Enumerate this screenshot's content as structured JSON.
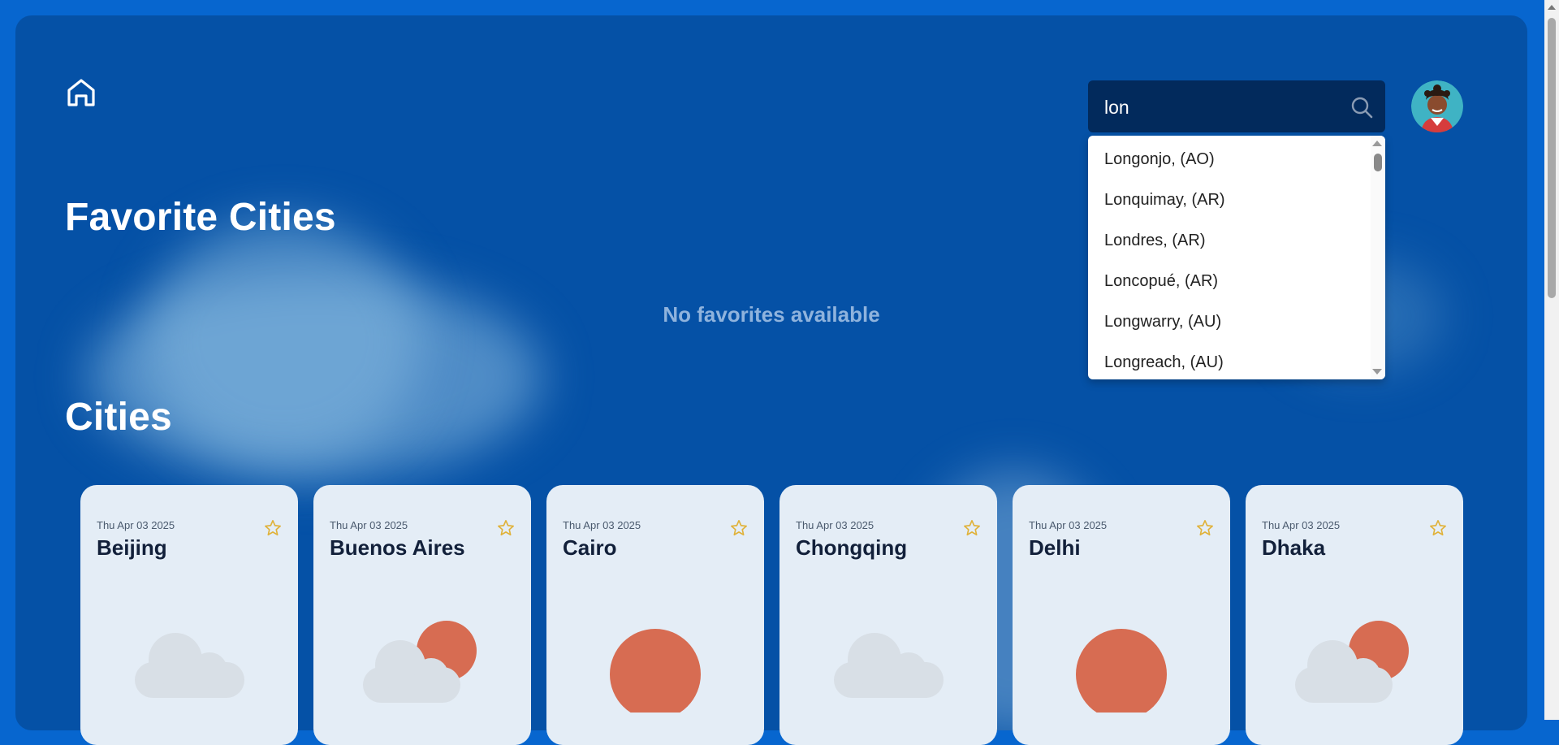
{
  "header": {
    "home_icon": "home-icon",
    "search": {
      "value": "lon",
      "placeholder": "",
      "icon": "search-icon"
    },
    "avatar_icon": "user-avatar"
  },
  "favorites": {
    "title": "Favorite Cities",
    "empty_message": "No favorites available"
  },
  "cities": {
    "title": "Cities"
  },
  "dropdown": {
    "items": [
      "Longonjo, (AO)",
      "Lonquimay, (AR)",
      "Londres, (AR)",
      "Loncopué, (AR)",
      "Longwarry, (AU)",
      "Longreach, (AU)"
    ]
  },
  "city_cards": [
    {
      "date": "Thu Apr 03 2025",
      "name": "Beijing",
      "weather_icon": "cloud-icon"
    },
    {
      "date": "Thu Apr 03 2025",
      "name": "Buenos Aires",
      "weather_icon": "partly-cloudy-icon"
    },
    {
      "date": "Thu Apr 03 2025",
      "name": "Cairo",
      "weather_icon": "sun-icon"
    },
    {
      "date": "Thu Apr 03 2025",
      "name": "Chongqing",
      "weather_icon": "cloud-icon"
    },
    {
      "date": "Thu Apr 03 2025",
      "name": "Delhi",
      "weather_icon": "sun-icon"
    },
    {
      "date": "Thu Apr 03 2025",
      "name": "Dhaka",
      "weather_icon": "partly-cloudy-icon"
    }
  ],
  "colors": {
    "page_bg": "#0766cf",
    "panel_bg": "#0551a6",
    "search_bg": "#022a5c",
    "card_bg": "#e4edf6",
    "sun": "#d76c52",
    "cloud": "#d8dfe6",
    "star": "#e0b23a"
  }
}
